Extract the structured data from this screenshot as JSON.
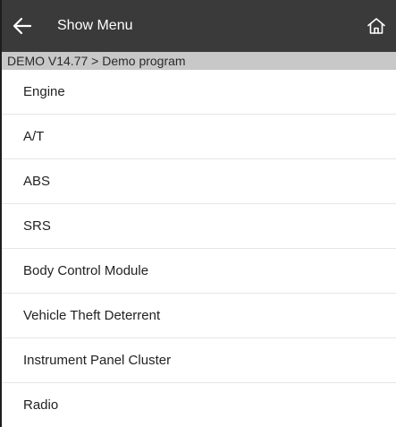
{
  "header": {
    "title": "Show Menu",
    "back_icon": "arrow-left-icon",
    "home_icon": "home-icon"
  },
  "breadcrumb": {
    "text": "DEMO V14.77 > Demo program"
  },
  "menu": {
    "items": [
      {
        "label": "Engine"
      },
      {
        "label": "A/T"
      },
      {
        "label": "ABS"
      },
      {
        "label": "SRS"
      },
      {
        "label": "Body Control Module"
      },
      {
        "label": "Vehicle Theft Deterrent"
      },
      {
        "label": "Instrument Panel Cluster"
      },
      {
        "label": "Radio"
      }
    ]
  },
  "colors": {
    "header_bg": "#3a3a3a",
    "breadcrumb_bg": "#c8c8c8",
    "divider": "#e6e6e6"
  }
}
